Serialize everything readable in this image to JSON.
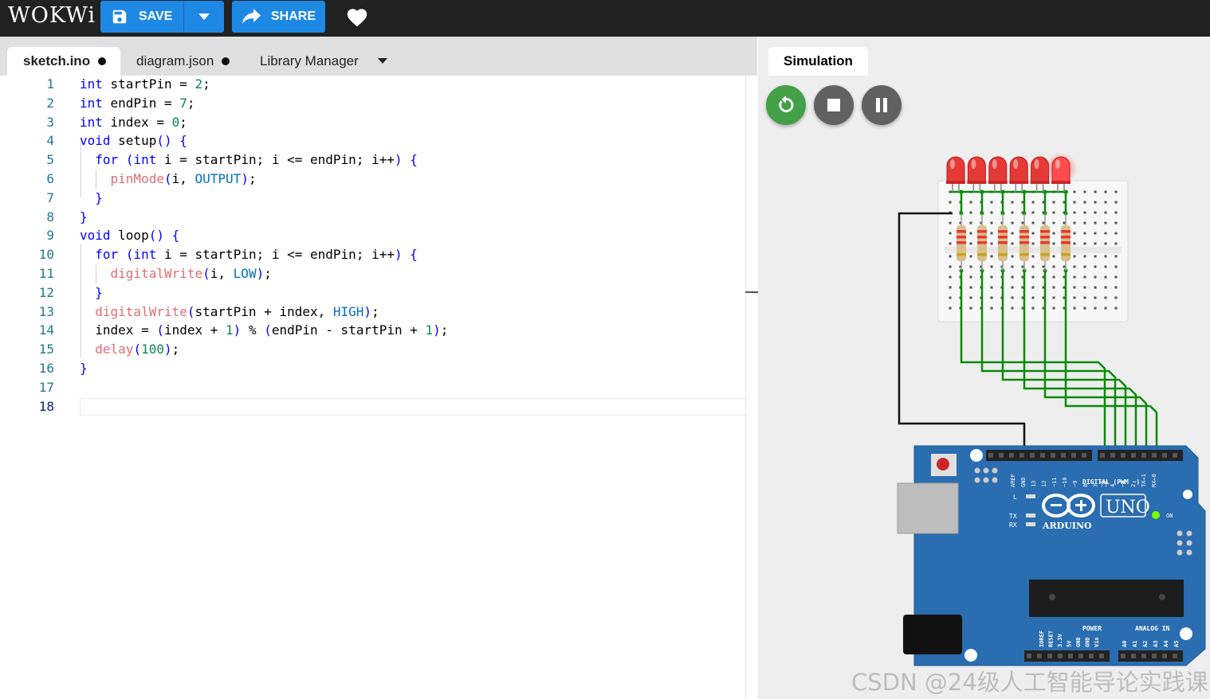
{
  "app": {
    "logo": "WOKWi"
  },
  "toolbar": {
    "save_label": "SAVE",
    "share_label": "SHARE"
  },
  "tabs": [
    {
      "label": "sketch.ino",
      "active": true,
      "modified": true
    },
    {
      "label": "diagram.json",
      "active": false,
      "modified": true
    },
    {
      "label": "Library Manager",
      "active": false,
      "modified": false
    }
  ],
  "editor": {
    "current_line": 18,
    "lines": [
      "int startPin = 2;",
      "int endPin = 7;",
      "int index = 0;",
      "void setup() {",
      "  for (int i = startPin; i <= endPin; i++) {",
      "    pinMode(i, OUTPUT);",
      "  }",
      "}",
      "void loop() {",
      "  for (int i = startPin; i <= endPin; i++) {",
      "    digitalWrite(i, LOW);",
      "  }",
      "  digitalWrite(startPin + index, HIGH);",
      "  index = (index + 1) % (endPin - startPin + 1);",
      "  delay(100);",
      "}",
      "",
      ""
    ]
  },
  "simulation": {
    "tab_label": "Simulation",
    "controls": [
      "restart",
      "stop",
      "pause"
    ],
    "leds": {
      "count": 6,
      "lit_index": 5,
      "color": "#e53935"
    },
    "board": {
      "brand": "ARDUINO",
      "model": "UNO",
      "digital_label": "DIGITAL (PWM ~)",
      "power_label": "POWER",
      "analog_label": "ANALOG IN",
      "on_label": "ON",
      "l_label": "L",
      "tx_label": "TX",
      "rx_label": "RX",
      "digital_pins": [
        "AREF",
        "GND",
        "13",
        "12",
        "~11",
        "~10",
        "~9",
        "8",
        "7",
        "~6",
        "~5",
        "4",
        "~3",
        "2",
        "TX→1",
        "RX←0"
      ],
      "power_pins": [
        "IOREF",
        "RESET",
        "3.3V",
        "5V",
        "GND",
        "GND",
        "Vin"
      ],
      "analog_pins": [
        "A0",
        "A1",
        "A2",
        "A3",
        "A4",
        "A5"
      ]
    }
  },
  "watermark": "CSDN @24级人工智能导论实践课",
  "colors": {
    "accent": "#1e88e5",
    "board": "#2a6db0",
    "wire_green": "#0a8a0a",
    "green_button": "#43a047",
    "gray_button": "#616161"
  }
}
